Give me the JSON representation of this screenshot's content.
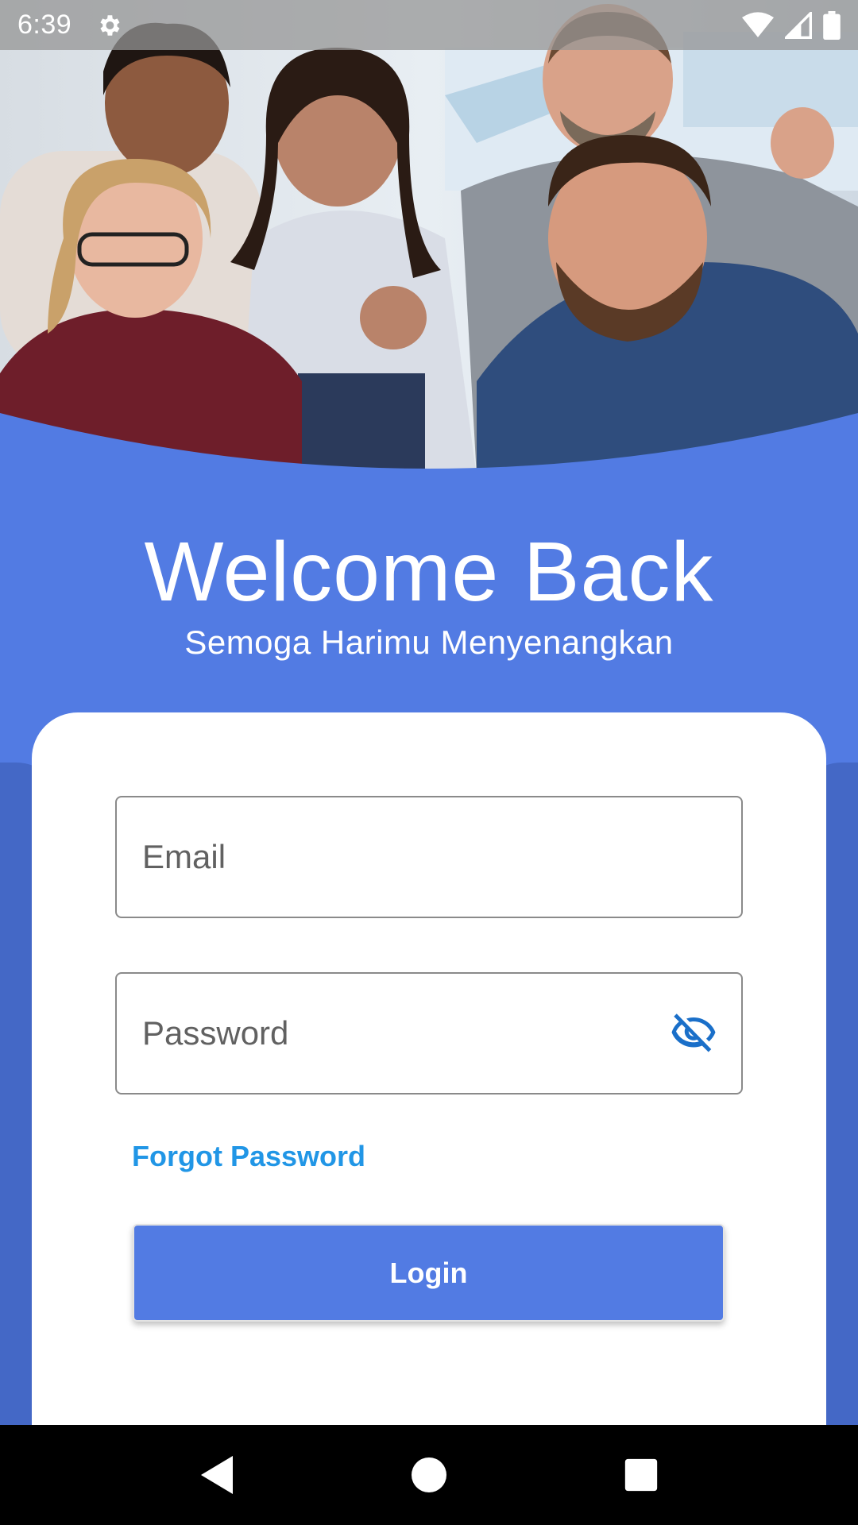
{
  "status_bar": {
    "time": "6:39",
    "icons": [
      "gear-icon",
      "wifi-icon",
      "signal-icon",
      "battery-icon"
    ]
  },
  "hero": {
    "image": "group-photo"
  },
  "header": {
    "title": "Welcome Back",
    "subtitle": "Semoga Harimu Menyenangkan"
  },
  "form": {
    "email_placeholder": "Email",
    "password_placeholder": "Password",
    "forgot_password_label": "Forgot Password",
    "login_label": "Login",
    "password_toggle_icon": "eye-off-icon"
  },
  "nav_bar": {
    "icons": [
      "back-icon",
      "home-icon",
      "recents-icon"
    ]
  },
  "colors": {
    "primary": "#527BE3",
    "link": "#2196E6",
    "icon_blue": "#1A6FC9"
  }
}
